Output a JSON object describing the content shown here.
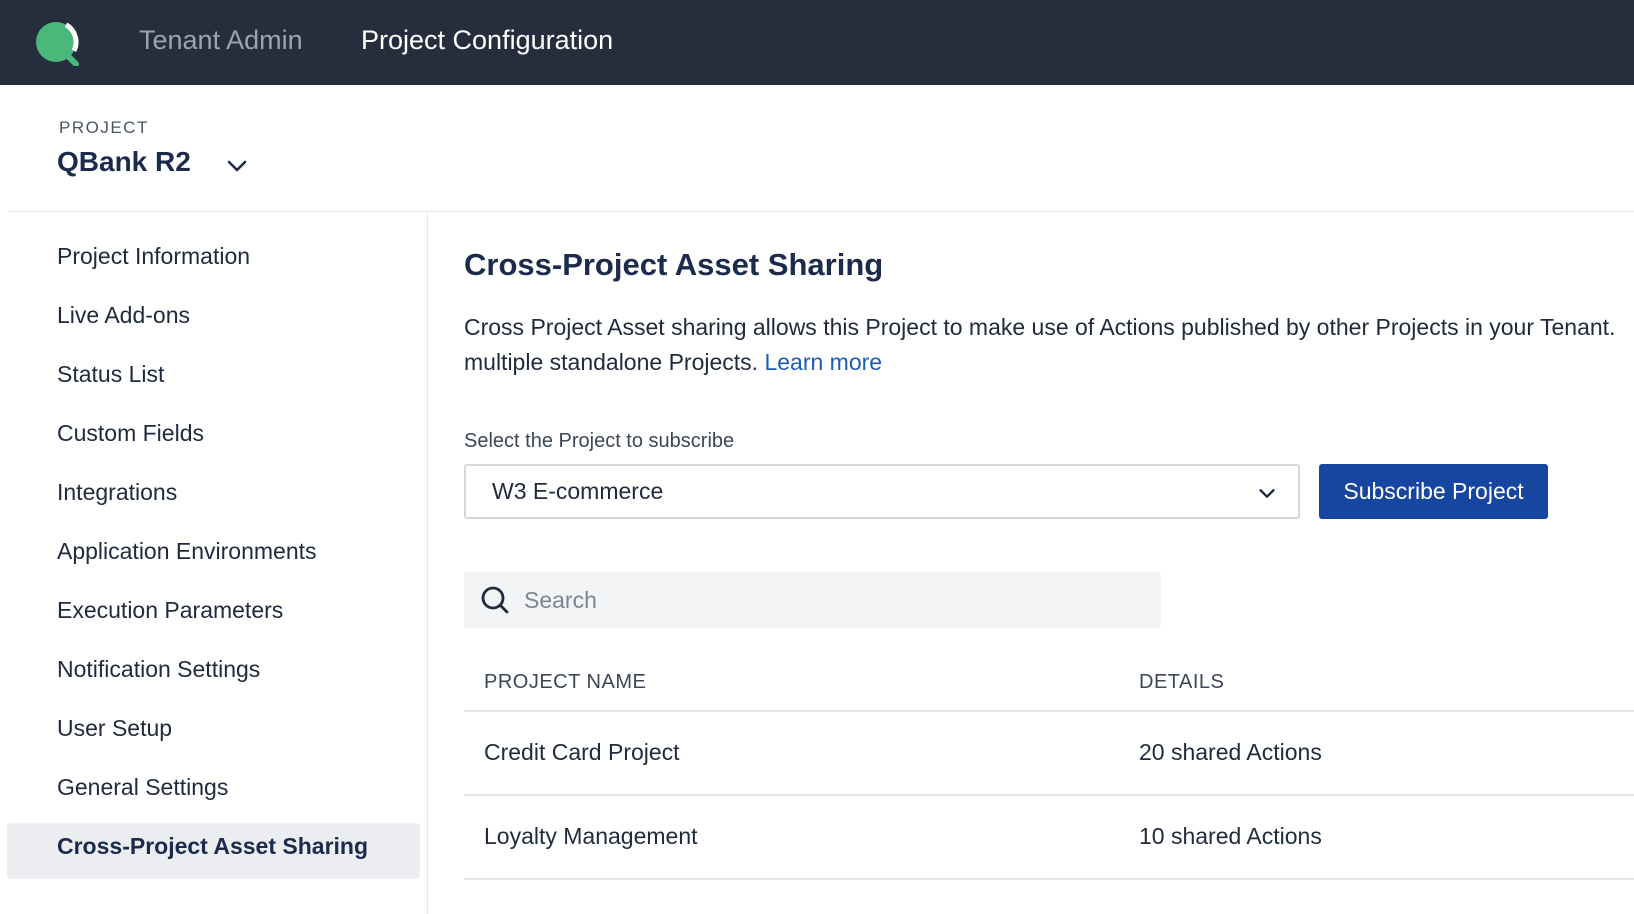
{
  "topbar": {
    "logo_icon": "q-logo-icon",
    "nav": [
      "Tenant Admin",
      "Project Configuration"
    ]
  },
  "project": {
    "label": "PROJECT",
    "name": "QBank R2"
  },
  "sidebar": {
    "items": [
      {
        "label": "Project Information"
      },
      {
        "label": "Live Add-ons"
      },
      {
        "label": "Status List"
      },
      {
        "label": "Custom Fields"
      },
      {
        "label": "Integrations"
      },
      {
        "label": "Application Environments"
      },
      {
        "label": "Execution Parameters"
      },
      {
        "label": "Notification Settings"
      },
      {
        "label": "User Setup"
      },
      {
        "label": "General Settings"
      },
      {
        "label": "Cross-Project Asset Sharing",
        "active": true
      }
    ]
  },
  "main": {
    "title": "Cross-Project Asset Sharing",
    "description_line1": "Cross Project Asset sharing allows this Project to make use of Actions published by other Projects in your Tenant.",
    "description_line2": "multiple standalone Projects.",
    "learn_more": "Learn more",
    "select_label": "Select the Project to subscribe",
    "select_value": "W3 E-commerce",
    "subscribe_button": "Subscribe Project",
    "search_placeholder": "Search",
    "table": {
      "headers": [
        "PROJECT NAME",
        "DETAILS"
      ],
      "rows": [
        {
          "name": "Credit Card Project",
          "details": "20 shared Actions"
        },
        {
          "name": "Loyalty Management",
          "details": "10 shared Actions"
        }
      ]
    }
  },
  "colors": {
    "topbar_bg": "#262d3d",
    "accent": "#1646a0",
    "link": "#1a5fb4",
    "logo_green": "#49b87a"
  }
}
